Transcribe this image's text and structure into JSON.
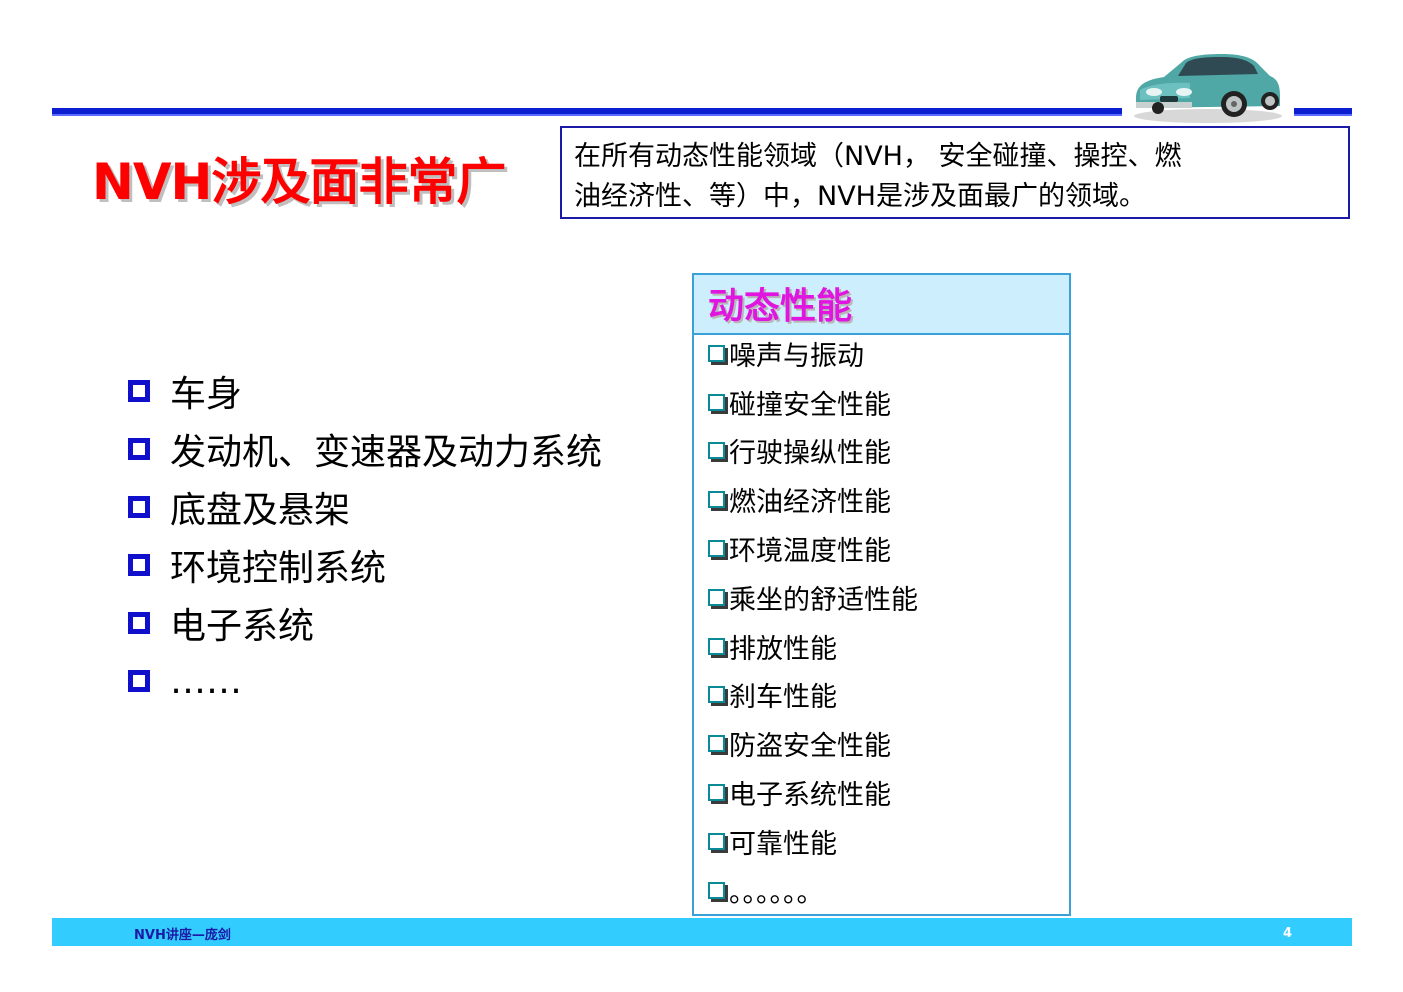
{
  "header": {
    "title": "NVH涉及面非常广",
    "callout_line1": "在所有动态性能领域（NVH， 安全碰撞、操控、燃",
    "callout_line2": "油经济性、等）中，NVH是涉及面最广的领域。"
  },
  "left_list": [
    {
      "label": "车身"
    },
    {
      "label": "发动机、变速器及动力系统"
    },
    {
      "label": "底盘及悬架"
    },
    {
      "label": "环境控制系统"
    },
    {
      "label": "电子系统"
    },
    {
      "label": "……"
    }
  ],
  "panel": {
    "title": "动态性能",
    "items": [
      {
        "label": "噪声与振动"
      },
      {
        "label": "碰撞安全性能"
      },
      {
        "label": "行驶操纵性能"
      },
      {
        "label": "燃油经济性能"
      },
      {
        "label": "环境温度性能"
      },
      {
        "label": "乘坐的舒适性能"
      },
      {
        "label": "排放性能"
      },
      {
        "label": "刹车性能"
      },
      {
        "label": "防盗安全性能"
      },
      {
        "label": "电子系统性能"
      },
      {
        "label": "可靠性能"
      },
      {
        "label": "。。。。。。"
      }
    ]
  },
  "footer": {
    "left_text": "NVH讲座—庞剑",
    "page_number": "4"
  },
  "colors": {
    "title": "#ff0000",
    "rule": "#0c1fd0",
    "panel_title": "#e016e0",
    "panel_header_bg": "#cdeefc",
    "footer_bg": "#33ccff",
    "bullet": "#1010cc"
  },
  "icons": {
    "car": "car-illustration",
    "main_bullet": "square-bullet-icon",
    "panel_bullet": "checkbox-bullet-icon"
  }
}
